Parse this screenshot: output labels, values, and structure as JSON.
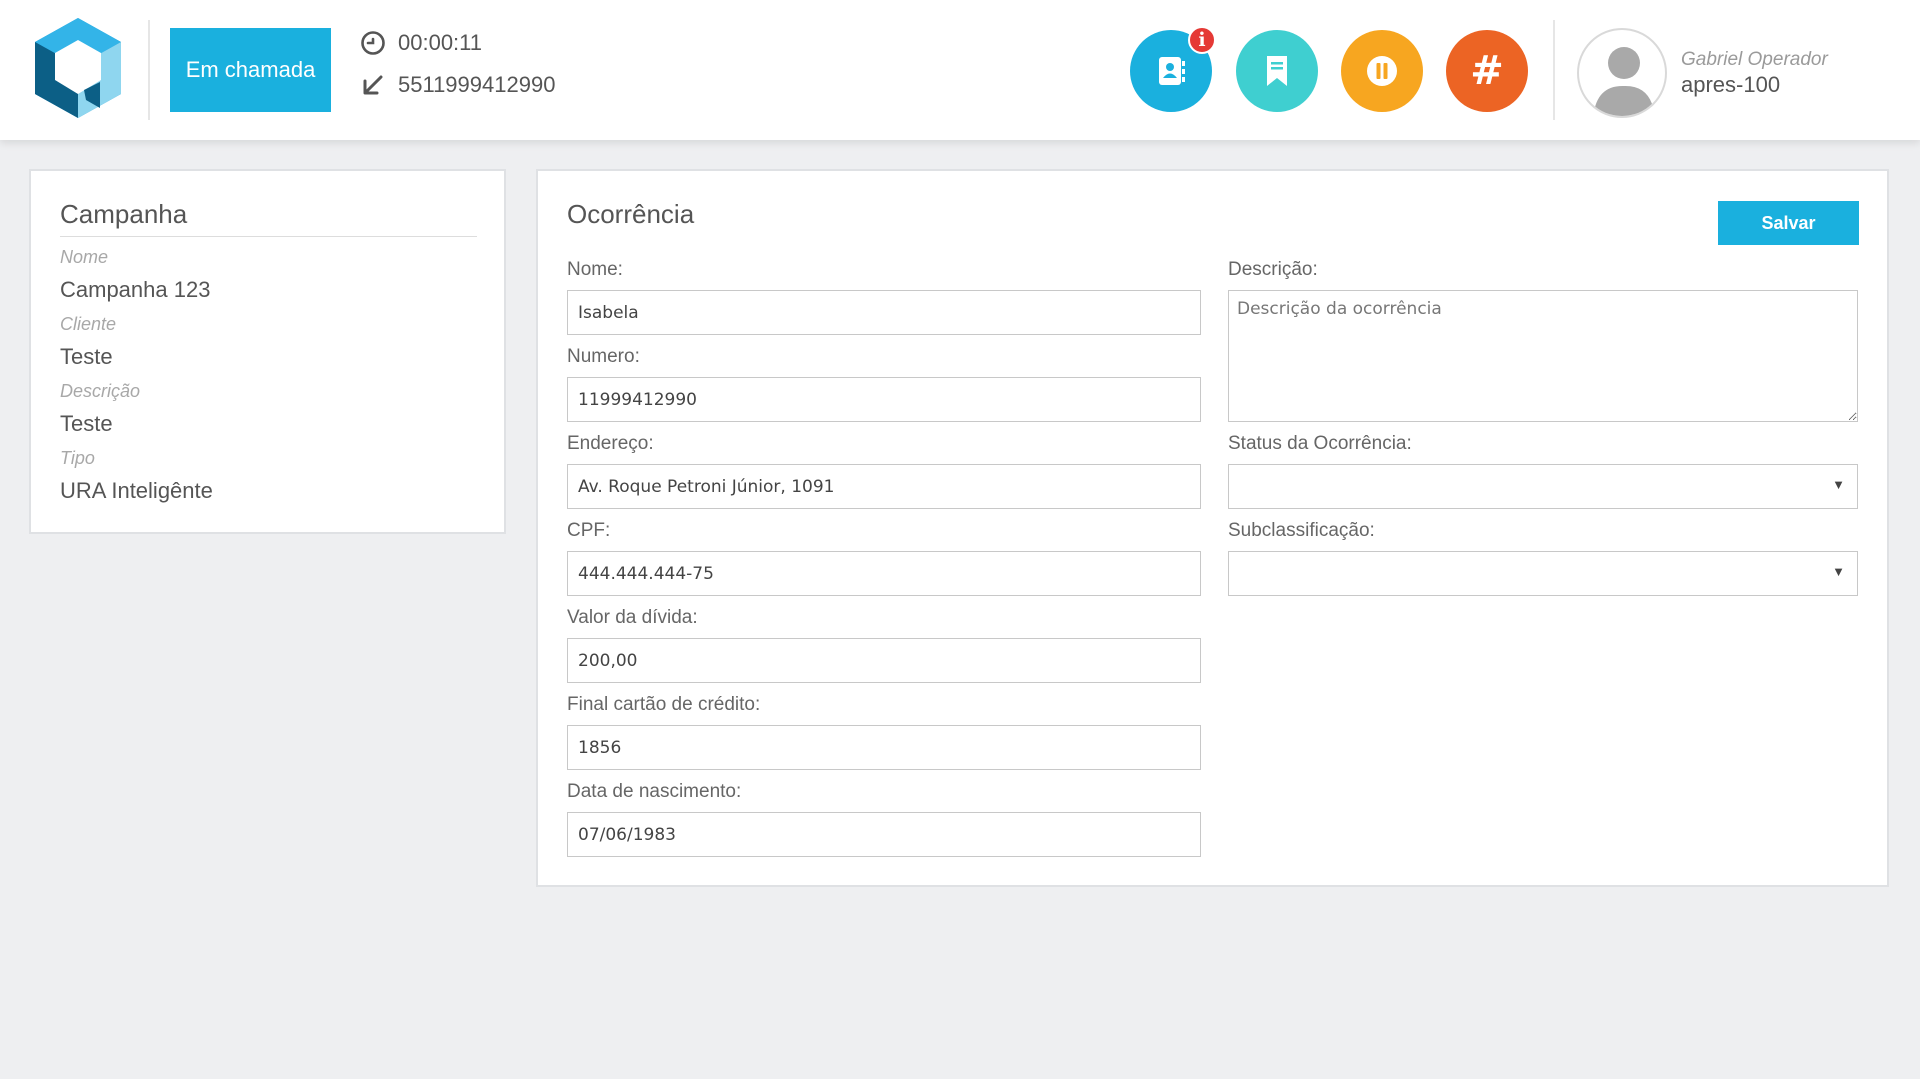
{
  "header": {
    "status_label": "Em chamada",
    "timer": "00:00:11",
    "phone_number": "5511999412990",
    "badge_count": "i",
    "actions": [
      {
        "name": "contacts",
        "color": "#1ab0de"
      },
      {
        "name": "bookmark",
        "color": "#3fcfd0"
      },
      {
        "name": "pause",
        "color": "#f7a620"
      },
      {
        "name": "dialpad",
        "color": "#ec6424",
        "glyph": "#"
      }
    ],
    "user": {
      "name": "Gabriel Operador",
      "extension": "apres-100"
    }
  },
  "campaign": {
    "title": "Campanha",
    "fields": [
      {
        "label": "Nome",
        "value": "Campanha 123"
      },
      {
        "label": "Cliente",
        "value": "Teste"
      },
      {
        "label": "Descrição",
        "value": "Teste"
      },
      {
        "label": "Tipo",
        "value": "URA Inteligênte"
      }
    ]
  },
  "occurrence": {
    "title": "Ocorrência",
    "save_label": "Salvar",
    "fields": [
      {
        "label": "Nome:",
        "value": "Isabela"
      },
      {
        "label": "Numero:",
        "value": "11999412990"
      },
      {
        "label": "Endereço:",
        "value": "Av. Roque Petroni Júnior, 1091"
      },
      {
        "label": "CPF:",
        "value": "444.444.444-75"
      },
      {
        "label": "Valor da dívida:",
        "value": "200,00"
      },
      {
        "label": "Final cartão de crédito:",
        "value": "1856"
      },
      {
        "label": "Data de nascimento:",
        "value": "07/06/1983"
      }
    ],
    "description": {
      "label": "Descrição:",
      "placeholder": "Descrição da ocorrência"
    },
    "status": {
      "label": "Status da Ocorrência:",
      "value": ""
    },
    "subclass": {
      "label": "Subclassificação:",
      "value": ""
    }
  },
  "colors": {
    "accent": "#1ab0de",
    "badge": "#e53935"
  }
}
